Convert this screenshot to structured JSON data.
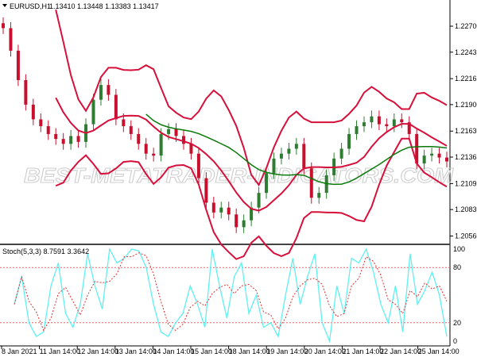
{
  "header": {
    "symbol": "EURUSD,H1",
    "ohlc": "1.13410 1.13448 1.13383 1.13417"
  },
  "watermark": "BEST-METATRADER-INDICATORS.COM",
  "colors": {
    "bull": "#2e7d32",
    "bear": "#c8102e",
    "bands": "#d6103a",
    "ma": "#0a7a0a",
    "stoch_k": "#5ff0f0",
    "stoch_d": "#e03030",
    "level": "#f06060"
  },
  "chart_data": [
    {
      "type": "line",
      "title": "EURUSD,H1",
      "ylim": [
        1.2043,
        1.2295
      ],
      "y_ticks": [
        "1.22700",
        "1.22435",
        "1.22165",
        "1.21900",
        "1.21630",
        "1.21365",
        "1.21095",
        "1.20830",
        "1.20560"
      ],
      "x_ticks": [
        "8 Jan 2021",
        "11 Jan 14:00",
        "12 Jan 14:00",
        "13 Jan 14:00",
        "14 Jan 14:00",
        "15 Jan 14:00",
        "18 Jan 14:00",
        "19 Jan 14:00",
        "20 Jan 14:00",
        "21 Jan 14:00",
        "22 Jan 14:00",
        "25 Jan 14:00"
      ],
      "close": [
        1.2268,
        1.2245,
        1.2215,
        1.219,
        1.2175,
        1.2168,
        1.216,
        1.2155,
        1.215,
        1.2158,
        1.2152,
        1.217,
        1.2195,
        1.221,
        1.22,
        1.2175,
        1.2168,
        1.216,
        1.215,
        1.214,
        1.2138,
        1.216,
        1.2165,
        1.2158,
        1.215,
        1.214,
        1.2115,
        1.209,
        1.208,
        1.2085,
        1.2078,
        1.2065,
        1.2072,
        1.2085,
        1.21,
        1.212,
        1.2135,
        1.214,
        1.2145,
        1.215,
        1.2125,
        1.2095,
        1.21,
        1.2118,
        1.2135,
        1.2145,
        1.216,
        1.2168,
        1.2172,
        1.2178,
        1.217,
        1.2168,
        1.2175,
        1.2172,
        1.216,
        1.213,
        1.2138,
        1.214,
        1.2136,
        1.2132
      ],
      "series": [
        "Bollinger Bands",
        "Moving Average"
      ]
    },
    {
      "type": "line",
      "title": "Stoch(5,3,3) 8.7591 3.3642",
      "ylim": [
        0,
        100
      ],
      "levels": [
        20,
        80
      ],
      "y_ticks": [
        "100",
        "80",
        "20",
        "0"
      ],
      "k": [
        40,
        70,
        20,
        5,
        10,
        60,
        85,
        30,
        15,
        40,
        95,
        60,
        35,
        100,
        85,
        90,
        100,
        98,
        80,
        40,
        10,
        5,
        20,
        30,
        60,
        40,
        15,
        100,
        60,
        25,
        70,
        85,
        30,
        50,
        15,
        20,
        5,
        50,
        90,
        40,
        70,
        95,
        20,
        0,
        60,
        30,
        90,
        85,
        100,
        75,
        40,
        20,
        60,
        10,
        95,
        40,
        55,
        75,
        50,
        5
      ]
    }
  ]
}
